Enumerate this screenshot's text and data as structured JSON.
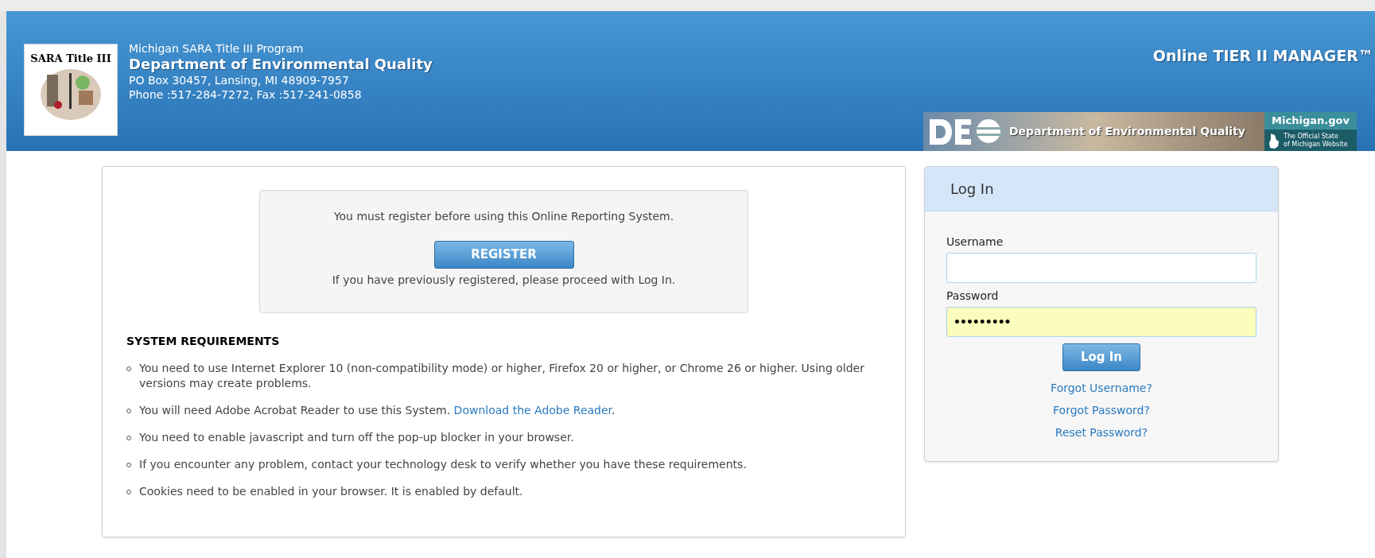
{
  "header": {
    "program": "Michigan SARA Title III Program",
    "department": "Department of Environmental Quality",
    "address": "PO Box 30457, Lansing, MI 48909-7957",
    "contact": "Phone :517-284-7272, Fax :517-241-0858",
    "logo_text": "SARA Title III",
    "app_title": "Online TIER II MANAGER™",
    "banner": {
      "agency": "Department of Environmental Quality",
      "portal": "Michigan.gov",
      "portal_tagline": [
        "The Official State",
        "of Michigan Website"
      ]
    }
  },
  "notice": {
    "message": "You must register before using this Online Reporting System.",
    "button": "REGISTER",
    "hint": "If you have previously registered, please proceed with Log In."
  },
  "requirements": {
    "heading": "SYSTEM REQUIREMENTS",
    "items": [
      {
        "text": "You need to use Internet Explorer 10 (non-compatibility mode) or higher, Firefox 20 or higher, or Chrome 26 or higher. Using older versions may create problems."
      },
      {
        "text": "You will need Adobe Acrobat Reader to use this System.",
        "link": "Download the Adobe Reader",
        "after": "."
      },
      {
        "text": "You need to enable javascript and turn off the pop-up blocker in your browser."
      },
      {
        "text": "If you encounter any problem, contact your technology desk to verify whether you have these requirements."
      },
      {
        "text": "Cookies need to be enabled in your browser. It is enabled by default."
      }
    ]
  },
  "login": {
    "title": "Log In",
    "fields": [
      {
        "label": "Username",
        "kind": "text",
        "autofilled": false
      },
      {
        "label": "Password",
        "kind": "password",
        "value": "•••••••••",
        "autofilled": true
      }
    ],
    "button": "Log In",
    "links": [
      "Forgot Username?",
      "Forgot Password?",
      "Reset Password?"
    ]
  }
}
